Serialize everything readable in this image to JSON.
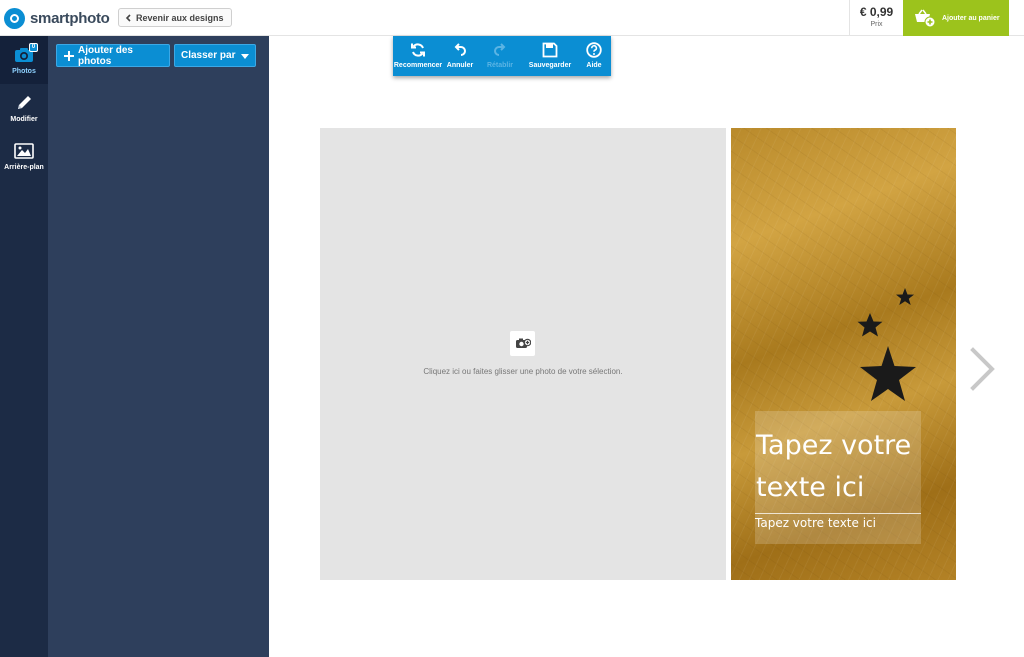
{
  "header": {
    "logo_text": "smartphoto",
    "back_label": "Revenir aux designs",
    "price_value": "€ 0,99",
    "price_label": "Prix",
    "cart_label": "Ajouter au panier"
  },
  "sidebar": {
    "items": [
      {
        "label": "Photos",
        "icon": "camera-icon",
        "badge": "0"
      },
      {
        "label": "Modifier",
        "icon": "pencil-icon"
      },
      {
        "label": "Arrière-plan",
        "icon": "image-icon"
      }
    ]
  },
  "panel": {
    "add_label": "Ajouter des photos",
    "sort_label": "Classer par"
  },
  "toolbar": {
    "items": [
      {
        "label": "Recommencer",
        "icon": "refresh-icon",
        "enabled": true
      },
      {
        "label": "Annuler",
        "icon": "undo-icon",
        "enabled": true
      },
      {
        "label": "Rétablir",
        "icon": "redo-icon",
        "enabled": false
      },
      {
        "label": "Sauvegarder",
        "icon": "save-icon",
        "enabled": true
      },
      {
        "label": "Aide",
        "icon": "help-icon",
        "enabled": true
      }
    ]
  },
  "canvas": {
    "drop_text": "Cliquez ici ou faites glisser une photo de votre sélection.",
    "title_line1": "Tapez votre",
    "title_line2": "texte ici",
    "subtitle": "Tapez votre texte ici"
  },
  "colors": {
    "brand_blue": "#0b8ed3",
    "cart_green": "#9cc31c",
    "sidebar_dark": "#1c2b45",
    "panel_bg": "#2e3f5c"
  }
}
